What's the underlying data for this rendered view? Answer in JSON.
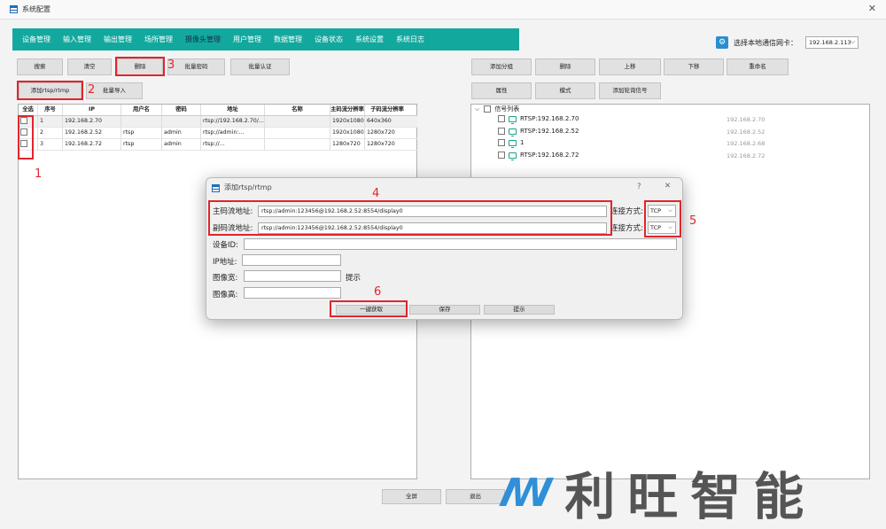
{
  "window": {
    "title": "系统配置",
    "close": "✕"
  },
  "tabs": [
    "设备管理",
    "输入管理",
    "输出管理",
    "场所管理",
    "摄像头管理",
    "用户管理",
    "数据管理",
    "设备状态",
    "系统设置",
    "系统日志"
  ],
  "nic": {
    "label": "选择本地通信网卡：",
    "value": "192.168.2.113"
  },
  "left_toolbar": {
    "search": "搜索",
    "clear": "清空",
    "delete": "删除",
    "batch_password": "批量密码",
    "batch_auth": "批量认证",
    "add_rtsp": "添加rtsp/rtmp",
    "batch_import": "批量导入"
  },
  "table": {
    "columns": [
      "全选",
      "序号",
      "IP",
      "用户名",
      "密码",
      "地址",
      "名称",
      "主码流分辨率",
      "子码流分辨率"
    ],
    "rows": [
      {
        "no": "1",
        "ip": "192.168.2.70",
        "user": "",
        "pass": "",
        "addr": "rtsp://192.168.2.70/...",
        "name": "",
        "main": "1920x1080",
        "sub": "640x360"
      },
      {
        "no": "2",
        "ip": "192.168.2.52",
        "user": "rtsp",
        "pass": "admin",
        "addr": "rtsp://admin:...",
        "name": "",
        "main": "1920x1080",
        "sub": "1280x720"
      },
      {
        "no": "3",
        "ip": "192.168.2.72",
        "user": "rtsp",
        "pass": "admin",
        "addr": "rtsp://...",
        "name": "",
        "main": "1280x720",
        "sub": "1280x720"
      }
    ]
  },
  "right_toolbar": {
    "add_group": "添加分组",
    "delete": "删除",
    "up": "上移",
    "down": "下移",
    "rename": "重命名",
    "properties": "属性",
    "mode": "模式",
    "add_poll": "添加轮询信号"
  },
  "tree": {
    "root": "信号列表",
    "items": [
      {
        "label": "RTSP:192.168.2.70",
        "tip": "192.168.2.70"
      },
      {
        "label": "RTSP:192.168.2.52",
        "tip": "192.168.2.52"
      },
      {
        "label": "1",
        "tip": "192.168.2.68"
      },
      {
        "label": "RTSP:192.168.2.72",
        "tip": "192.168.2.72"
      }
    ]
  },
  "dialog": {
    "title": "添加rtsp/rtmp",
    "help": "?",
    "close": "✕",
    "main_label": "主码流地址:",
    "main_value": "rtsp://admin:123456@192.168.2.52:8554/display0",
    "sub_label": "副码流地址:",
    "sub_value": "rtsp://admin:123456@192.168.2.52:8554/display0",
    "conn_label": "连接方式:",
    "conn_value": "TCP",
    "device_id_label": "设备ID:",
    "ip_label": "IP地址:",
    "width_label": "图像宽:",
    "height_label": "图像高:",
    "hint": "提示",
    "btn_fetch": "一键获取",
    "btn_save": "保存",
    "btn_hint": "提示"
  },
  "bottom": {
    "fullscreen": "全屏",
    "exit": "退出"
  },
  "annotations": [
    "1",
    "2",
    "3",
    "4",
    "5",
    "6"
  ],
  "logo": {
    "text": "利旺智能"
  },
  "colors": {
    "tab_bar": "#13a89e",
    "highlight": "#e0252b",
    "accent": "#2a8fcf"
  }
}
